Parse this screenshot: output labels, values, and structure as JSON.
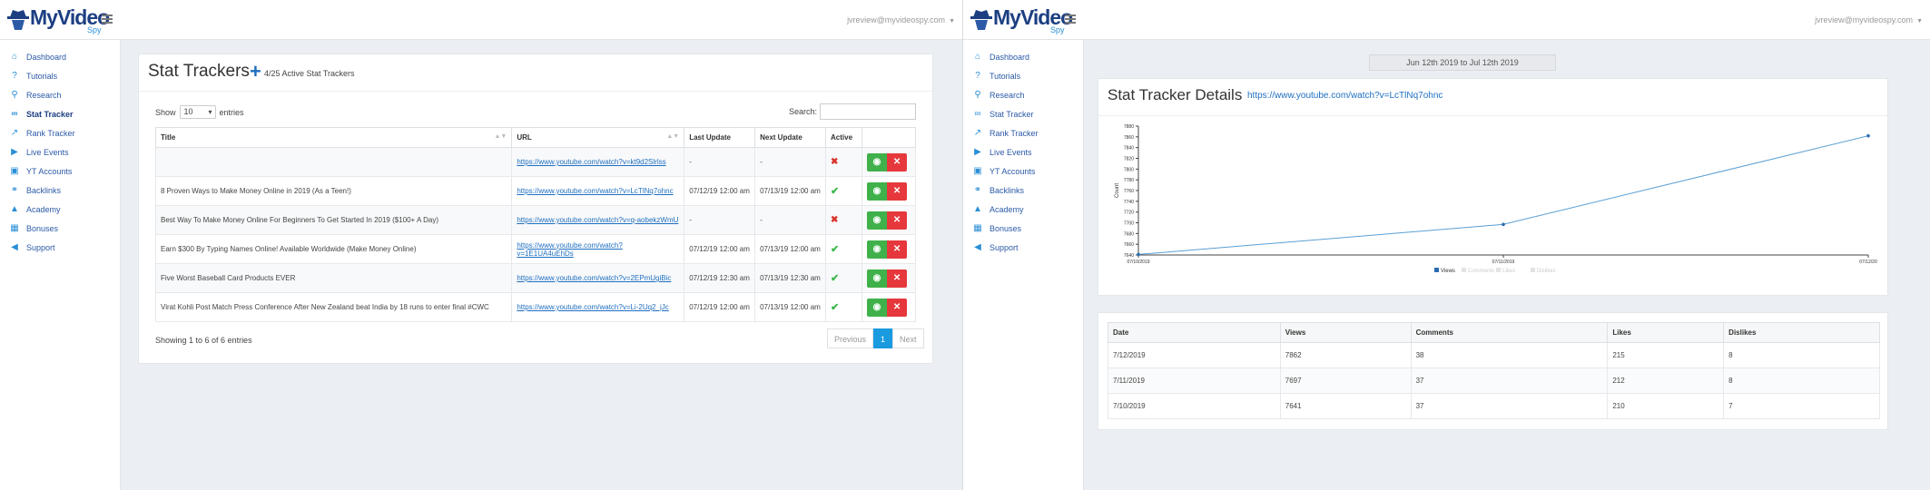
{
  "brand": {
    "name": "MyVideo",
    "sub": "Spy"
  },
  "user_email": "jvreview@myvideospy.com",
  "sidebar": [
    {
      "label": "Dashboard",
      "icon": "home-icon"
    },
    {
      "label": "Tutorials",
      "icon": "question-icon"
    },
    {
      "label": "Research",
      "icon": "search-icon"
    },
    {
      "label": "Stat Tracker",
      "icon": "binoculars-icon"
    },
    {
      "label": "Rank Tracker",
      "icon": "line-chart-icon"
    },
    {
      "label": "Live Events",
      "icon": "play-circle-icon"
    },
    {
      "label": "YT Accounts",
      "icon": "youtube-icon"
    },
    {
      "label": "Backlinks",
      "icon": "link-icon"
    },
    {
      "label": "Academy",
      "icon": "graduation-cap-icon"
    },
    {
      "label": "Bonuses",
      "icon": "gift-icon"
    },
    {
      "label": "Support",
      "icon": "bullhorn-icon"
    }
  ],
  "trackers": {
    "title": "Stat Trackers",
    "count_text": "4/25 Active Stat Trackers",
    "show_label": "Show",
    "entries_label": "entries",
    "page_size": "10",
    "search_label": "Search:",
    "columns": [
      "Title",
      "URL",
      "Last Update",
      "Next Update",
      "Active"
    ],
    "rows": [
      {
        "title": "",
        "url": "https://www.youtube.com/watch?v=kt9d2Slrlss",
        "last": "-",
        "next": "-",
        "active": false
      },
      {
        "title": "8 Proven Ways to Make Money Online in 2019 (As a Teen!)",
        "url": "https://www.youtube.com/watch?v=LcTlNq7ohnc",
        "last": "07/12/19 12:00 am",
        "next": "07/13/19 12:00 am",
        "active": true
      },
      {
        "title": "Best Way To Make Money Online For Beginners To Get Started In 2019 ($100+ A Day)",
        "url": "https://www.youtube.com/watch?v=q-aobekzWmU",
        "last": "-",
        "next": "-",
        "active": false
      },
      {
        "title": "Earn $300 By Typing Names Online! Available Worldwide (Make Money Online)",
        "url": "https://www.youtube.com/watch?v=1E1UA4uEhDs",
        "last": "07/12/19 12:00 am",
        "next": "07/13/19 12:00 am",
        "active": true
      },
      {
        "title": "Five Worst Baseball Card Products EVER",
        "url": "https://www.youtube.com/watch?v=2EPmUgiBic",
        "last": "07/12/19 12:30 am",
        "next": "07/13/19 12:30 am",
        "active": true
      },
      {
        "title": "Virat Kohli Post Match Press Conference After New Zealand beat India by 18 runs to enter final #CWC",
        "url": "https://www.youtube.com/watch?v=Li-2Uq2_jJc",
        "last": "07/12/19 12:00 am",
        "next": "07/13/19 12:00 am",
        "active": true
      }
    ],
    "showing": "Showing 1 to 6 of 6 entries",
    "pager": {
      "prev": "Previous",
      "page": "1",
      "next": "Next"
    }
  },
  "details": {
    "date_range": "Jun 12th 2019 to Jul 12th 2019",
    "title": "Stat Tracker Details",
    "url": "https://www.youtube.com/watch?v=LcTlNq7ohnc",
    "history_columns": [
      "Date",
      "Views",
      "Comments",
      "Likes",
      "Dislikes"
    ],
    "history": [
      [
        "7/12/2019",
        "7862",
        "38",
        "215",
        "8"
      ],
      [
        "7/11/2019",
        "7697",
        "37",
        "212",
        "8"
      ],
      [
        "7/10/2019",
        "7641",
        "37",
        "210",
        "7"
      ]
    ]
  },
  "chart_data": {
    "type": "line",
    "x": [
      "07/10/2019",
      "07/11/2019",
      "07/12/2019"
    ],
    "series": [
      {
        "name": "Views",
        "values": [
          7641,
          7697,
          7862
        ],
        "color": "#5a9fd4"
      },
      {
        "name": "Comments",
        "values": [],
        "color": "#dddddd"
      },
      {
        "name": "Likes",
        "values": [],
        "color": "#dddddd"
      },
      {
        "name": "Dislikes",
        "values": [],
        "color": "#dddddd"
      }
    ],
    "ylabel": "Count",
    "ylim": [
      7640,
      7880
    ],
    "yticks": [
      7640,
      7660,
      7680,
      7700,
      7720,
      7740,
      7760,
      7780,
      7800,
      7820,
      7840,
      7860,
      7880
    ],
    "xticks": [
      "07/10/2019",
      "07/11/2019",
      "07/12/20"
    ],
    "legend": "bottom"
  }
}
